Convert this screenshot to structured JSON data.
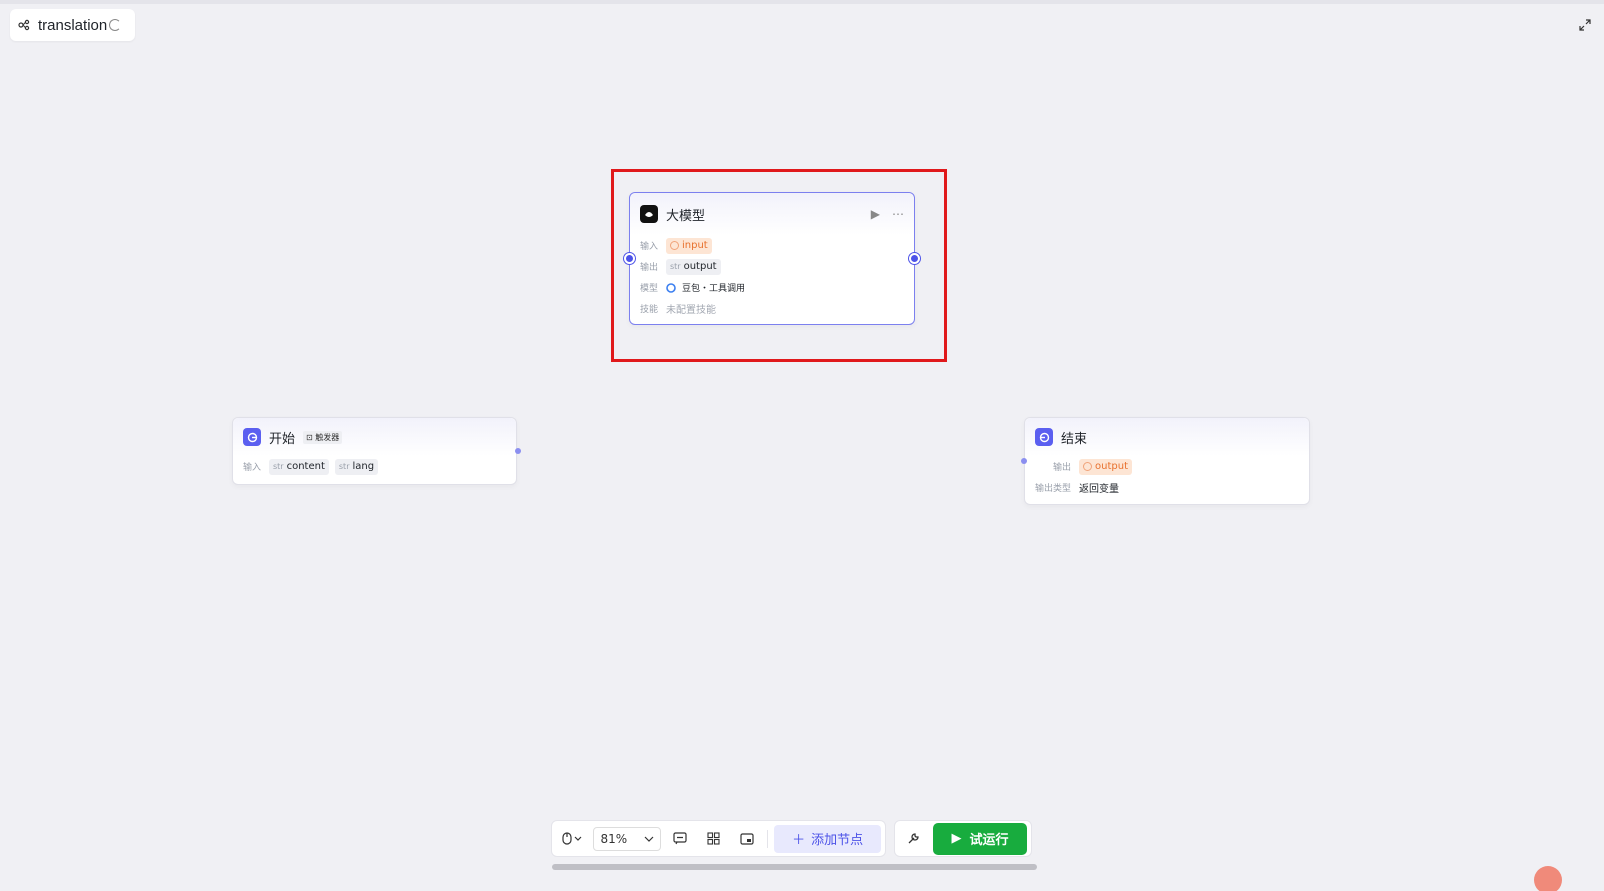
{
  "workflow": {
    "title": "translation"
  },
  "llm_node": {
    "title": "大模型",
    "input_label": "输入",
    "input_value": "input",
    "output_label": "输出",
    "output_type": "str",
    "output_value": "output",
    "model_label": "模型",
    "model_value": "豆包・工具调用",
    "skill_label": "技能",
    "skill_value": "未配置技能"
  },
  "start_node": {
    "title": "开始",
    "trigger_label": "触发器",
    "input_label": "输入",
    "inputs": [
      {
        "type": "str",
        "name": "content"
      },
      {
        "type": "str",
        "name": "lang"
      }
    ]
  },
  "end_node": {
    "title": "结束",
    "output_label": "输出",
    "output_value": "output",
    "output_type_label": "输出类型",
    "output_type_value": "返回变量"
  },
  "toolbar": {
    "zoom": "81%",
    "add_node_label": "添加节点",
    "run_label": "试运行"
  },
  "colors": {
    "accent": "#4d53e8",
    "run": "#18ac3e",
    "highlight": "#e0191b",
    "warn_bg": "#fde5d4",
    "warn_text": "#e8712e"
  }
}
